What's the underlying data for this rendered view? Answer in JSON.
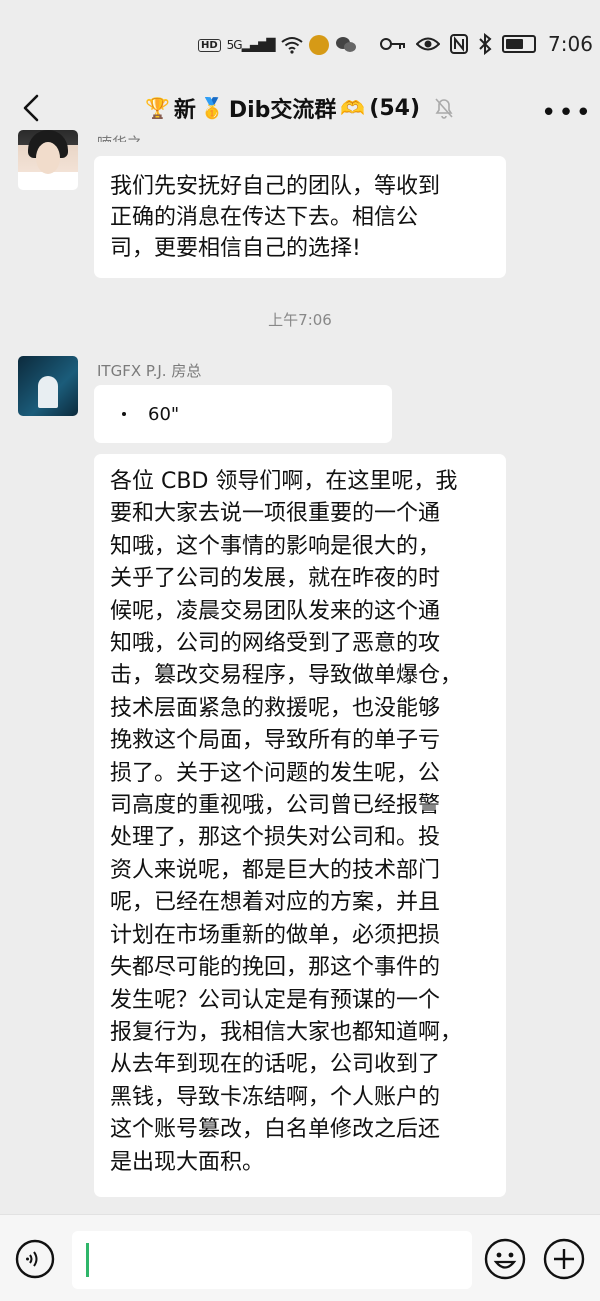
{
  "status_bar": {
    "hd": "HD",
    "signal": "5G",
    "time": "7:06"
  },
  "header": {
    "trophy": "🏆",
    "title_part1": "新",
    "medal": "🥇",
    "title_part2": "Dib交流群",
    "hands": "🫶",
    "member_count": "(54)"
  },
  "messages": [
    {
      "sender": "喃华之",
      "text": "我们先安抚好自己的团队，等收到\n正确的消息在传达下去。相信公\n司，更要相信自己的选择!"
    },
    {
      "time_label": "上午7:06"
    },
    {
      "sender": "ITGFX P.J. 房总",
      "voice_duration": "60\""
    },
    {
      "text": "各位 CBD 领导们啊，在这里呢，我\n要和大家去说一项很重要的一个通\n知哦，这个事情的影响是很大的，\n关乎了公司的发展，就在昨夜的时\n候呢，凌晨交易团队发来的这个通\n知哦，公司的网络受到了恶意的攻\n击，篡改交易程序，导致做单爆仓，\n技术层面紧急的救援呢，也没能够\n挽救这个局面，导致所有的单子亏\n损了。关于这个问题的发生呢，公\n司高度的重视哦，公司曾已经报警\n处理了，那这个损失对公司和。投\n资人来说呢，都是巨大的技术部门\n呢，已经在想着对应的方案，并且\n计划在市场重新的做单，必须把损\n失都尽可能的挽回，那这个事件的\n发生呢？公司认定是有预谋的一个\n报复行为，我相信大家也都知道啊，\n从去年到现在的话呢，公司收到了\n黑钱，导致卡冻结啊，个人账户的\n这个账号篡改，白名单修改之后还\n是出现大面积。"
    }
  ],
  "input": {
    "value": "",
    "placeholder": ""
  }
}
